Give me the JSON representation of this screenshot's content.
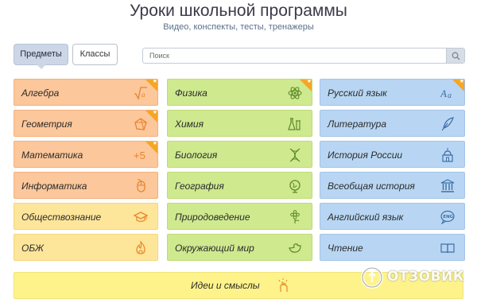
{
  "header": {
    "title": "Уроки школьной программы",
    "subtitle": "Видео, конспекты, тесты, тренажеры"
  },
  "tabs": {
    "active": "Предметы",
    "inactive": "Классы"
  },
  "search": {
    "placeholder": "Поиск",
    "value": ""
  },
  "columns": [
    [
      {
        "label": "Алгебра",
        "icon": "sqrt-a-icon",
        "starred": true
      },
      {
        "label": "Геометрия",
        "icon": "polygon-icon",
        "starred": true
      },
      {
        "label": "Математика",
        "icon": "plus-five-icon",
        "starred": true
      },
      {
        "label": "Информатика",
        "icon": "mouse-icon",
        "starred": false
      },
      {
        "label": "Обществознание",
        "icon": "graduation-cap-icon",
        "starred": false
      },
      {
        "label": "ОБЖ",
        "icon": "flame-icon",
        "starred": false
      }
    ],
    [
      {
        "label": "Физика",
        "icon": "atom-icon",
        "starred": true
      },
      {
        "label": "Химия",
        "icon": "flasks-icon",
        "starred": false
      },
      {
        "label": "Биология",
        "icon": "dna-icon",
        "starred": false
      },
      {
        "label": "География",
        "icon": "globe-icon",
        "starred": false
      },
      {
        "label": "Природоведение",
        "icon": "flower-icon",
        "starred": false
      },
      {
        "label": "Окружающий мир",
        "icon": "bird-icon",
        "starred": false
      }
    ],
    [
      {
        "label": "Русский язык",
        "icon": "letters-aa-icon",
        "starred": true
      },
      {
        "label": "Литература",
        "icon": "quill-icon",
        "starred": false
      },
      {
        "label": "История России",
        "icon": "church-icon",
        "starred": false
      },
      {
        "label": "Всеобщая история",
        "icon": "columns-building-icon",
        "starred": false
      },
      {
        "label": "Английский язык",
        "icon": "eng-bubble-icon",
        "starred": false
      },
      {
        "label": "Чтение",
        "icon": "open-book-icon",
        "starred": false
      }
    ]
  ],
  "ideas": {
    "label": "Идеи и смыслы",
    "icon": "hand-ideas-icon"
  },
  "watermark": {
    "text": "ОТЗОВИК"
  },
  "colors": {
    "orange": "#fcc79a",
    "yellow": "#fde59a",
    "green": "#cfe98f",
    "blue": "#b8d6f3",
    "ideas": "#fdf38a",
    "star": "#f5a623",
    "icon_orange": "#e8832b",
    "icon_green": "#5d8a2a",
    "icon_blue": "#3f6fa8"
  }
}
